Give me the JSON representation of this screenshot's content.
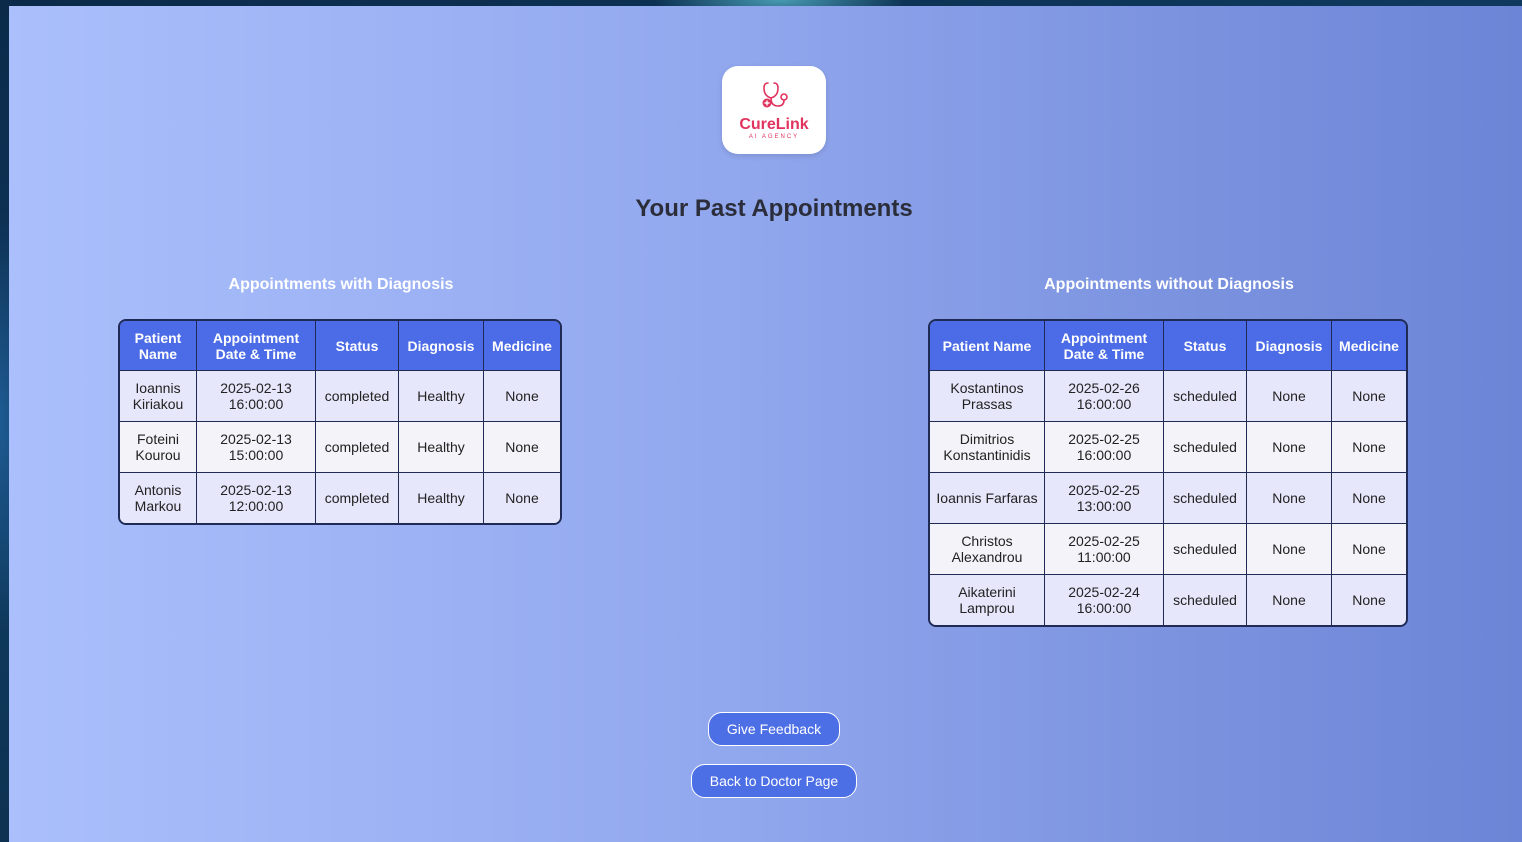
{
  "logo": {
    "name": "CureLink",
    "tagline": "AI AGENCY",
    "icon": "stethoscope-icon",
    "brand_color": "#e0345f"
  },
  "page_title": "Your Past Appointments",
  "with_diagnosis": {
    "title": "Appointments with Diagnosis",
    "columns": [
      "Patient Name",
      "Appointment Date & Time",
      "Status",
      "Diagnosis",
      "Medicine"
    ],
    "rows": [
      [
        "Ioannis Kiriakou",
        "2025-02-13 16:00:00",
        "completed",
        "Healthy",
        "None"
      ],
      [
        "Foteini Kourou",
        "2025-02-13 15:00:00",
        "completed",
        "Healthy",
        "None"
      ],
      [
        "Antonis Markou",
        "2025-02-13 12:00:00",
        "completed",
        "Healthy",
        "None"
      ]
    ]
  },
  "without_diagnosis": {
    "title": "Appointments without Diagnosis",
    "columns": [
      "Patient Name",
      "Appointment Date & Time",
      "Status",
      "Diagnosis",
      "Medicine"
    ],
    "rows": [
      [
        "Kostantinos Prassas",
        "2025-02-26 16:00:00",
        "scheduled",
        "None",
        "None"
      ],
      [
        "Dimitrios Konstantinidis",
        "2025-02-25 16:00:00",
        "scheduled",
        "None",
        "None"
      ],
      [
        "Ioannis Farfaras",
        "2025-02-25 13:00:00",
        "scheduled",
        "None",
        "None"
      ],
      [
        "Christos Alexandrou",
        "2025-02-25 11:00:00",
        "scheduled",
        "None",
        "None"
      ],
      [
        "Aikaterini Lamprou",
        "2025-02-24 16:00:00",
        "scheduled",
        "None",
        "None"
      ]
    ]
  },
  "buttons": {
    "feedback": "Give Feedback",
    "back": "Back to Doctor Page"
  },
  "colors": {
    "header_bg": "#4b6ce6",
    "button_bg": "#4d6fe6",
    "row_odd": "#e6e7fb",
    "row_even": "#f3f3f9"
  }
}
